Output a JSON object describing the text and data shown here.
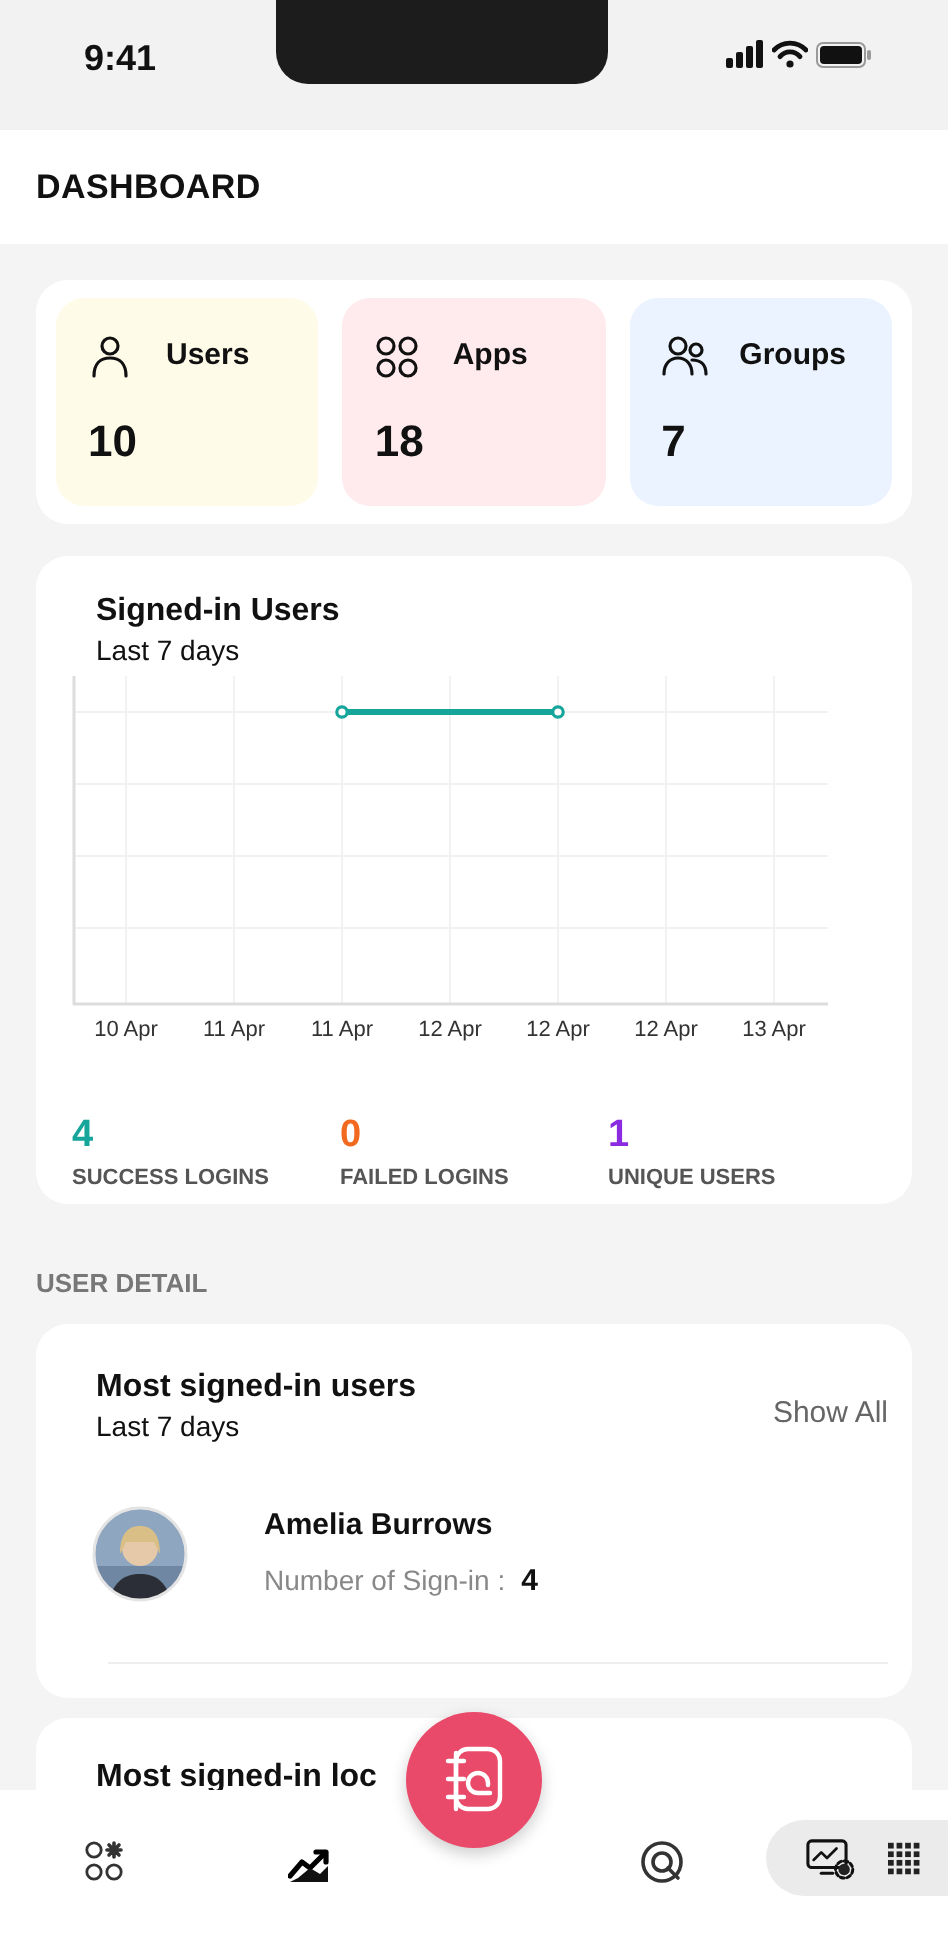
{
  "status_bar": {
    "time": "9:41"
  },
  "header": {
    "title": "DASHBOARD"
  },
  "summary_tiles": [
    {
      "kind": "users",
      "label": "Users",
      "count": "10",
      "color": "#fffbe9"
    },
    {
      "kind": "apps",
      "label": "Apps",
      "count": "18",
      "color": "#ffebee"
    },
    {
      "kind": "groups",
      "label": "Groups",
      "count": "7",
      "color": "#eaf3ff"
    }
  ],
  "signed_in_chart": {
    "title": "Signed-in Users",
    "subtitle": "Last 7 days",
    "x_labels": [
      "10 Apr",
      "11 Apr",
      "11 Apr",
      "12 Apr",
      "12 Apr",
      "12 Apr",
      "13 Apr"
    ],
    "stats": [
      {
        "value": "4",
        "label": "SUCCESS LOGINS",
        "color": "#16a59a"
      },
      {
        "value": "0",
        "label": "FAILED LOGINS",
        "color": "#f26a1f"
      },
      {
        "value": "1",
        "label": "UNIQUE USERS",
        "color": "#8a2be2"
      }
    ]
  },
  "section_heading": "USER DETAIL",
  "most_signed_in_users": {
    "title": "Most signed-in users",
    "subtitle": "Last 7 days",
    "action": "Show All",
    "users": [
      {
        "name": "Amelia Burrows",
        "metric_label": "Number of Sign-in :",
        "metric_value": "4"
      }
    ]
  },
  "next_card": {
    "title": "Most signed-in loc"
  },
  "bottom_nav": [
    {
      "kind": "apps",
      "selected": false
    },
    {
      "kind": "reports",
      "selected": true
    },
    {
      "kind": "fab"
    },
    {
      "kind": "mentions",
      "selected": false
    },
    {
      "kind": "tray"
    }
  ]
}
